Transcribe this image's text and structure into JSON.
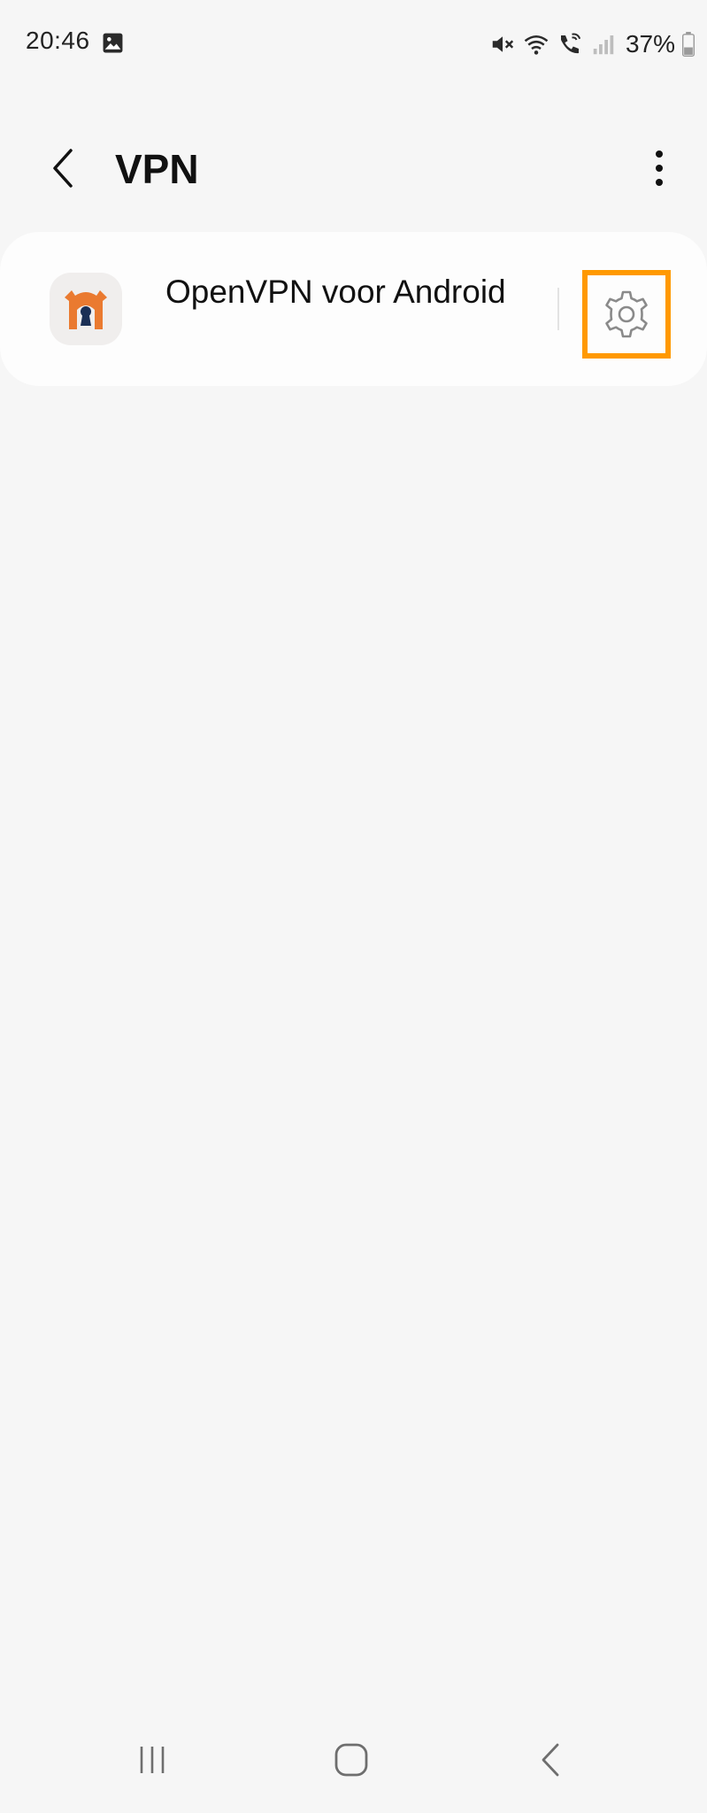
{
  "status_bar": {
    "time": "20:46",
    "battery": "37%",
    "icons": [
      "gallery-icon",
      "mute-icon",
      "wifi-icon",
      "wifi-calling-icon",
      "signal-icon",
      "battery-icon"
    ]
  },
  "header": {
    "title": "VPN",
    "back_icon": "chevron-left-icon",
    "more_icon": "more-vert-icon"
  },
  "vpn_list": {
    "items": [
      {
        "name": "OpenVPN voor Android",
        "icon": "openvpn-app-icon",
        "settings_icon": "gear-icon"
      }
    ]
  },
  "colors": {
    "background": "#f6f6f6",
    "card": "#fdfdfd",
    "highlight": "#ff9900",
    "openvpn_orange": "#ea7a30",
    "openvpn_navy": "#1b2f55"
  },
  "nav_bar": {
    "buttons": [
      "recents-icon",
      "home-icon",
      "back-icon"
    ]
  }
}
